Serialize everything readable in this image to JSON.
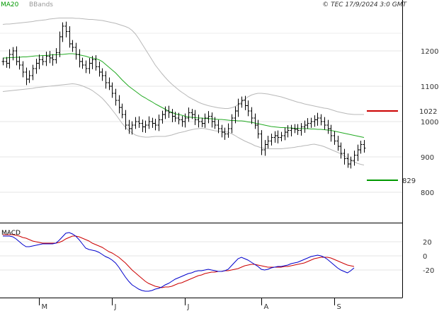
{
  "header": {
    "ma_label": "MA20",
    "bbands_label": "BBands",
    "copyright": "© TEC 17/9/2024 3:0 GMT"
  },
  "macd_label": "MACD",
  "levels": {
    "resistance": {
      "value": 1022,
      "label": "1022",
      "color": "#cc0000"
    },
    "support": {
      "value": 829,
      "label": "829",
      "color": "#009900"
    }
  },
  "colors": {
    "ma": "#22aa22",
    "bbands": "#b8b8b8",
    "macd": "#0000cc",
    "signal": "#cc0000",
    "ma_label": "#009900",
    "bbands_label": "#999999"
  },
  "chart_data": [
    {
      "type": "line",
      "title": "",
      "ylim": [
        700,
        1300
      ],
      "y_ticks": [
        800,
        900,
        1000,
        1100,
        1200
      ],
      "y_tick_labels": [
        "800",
        "900",
        "1000",
        "1100",
        "1200"
      ],
      "x_ticks": [
        {
          "label": "M",
          "index": 11
        },
        {
          "label": "J",
          "index": 33
        },
        {
          "label": "J",
          "index": 55
        },
        {
          "label": "A",
          "index": 78
        },
        {
          "label": "S",
          "index": 100
        }
      ],
      "series": [
        {
          "name": "",
          "kind": "ohlc",
          "close": [
            1170,
            1165,
            1190,
            1200,
            1170,
            1160,
            1140,
            1120,
            1130,
            1150,
            1165,
            1175,
            1170,
            1185,
            1180,
            1175,
            1195,
            1240,
            1270,
            1255,
            1220,
            1210,
            1190,
            1170,
            1160,
            1150,
            1165,
            1175,
            1155,
            1140,
            1130,
            1110,
            1100,
            1080,
            1060,
            1040,
            1020,
            990,
            980,
            990,
            1000,
            995,
            985,
            990,
            1000,
            995,
            990,
            1005,
            1020,
            1030,
            1025,
            1015,
            1010,
            1005,
            1000,
            1010,
            1025,
            1020,
            1005,
            1000,
            995,
            1010,
            1015,
            1000,
            990,
            980,
            970,
            965,
            980,
            1010,
            1030,
            1050,
            1060,
            1045,
            1030,
            1010,
            990,
            965,
            920,
            935,
            945,
            955,
            960,
            955,
            960,
            970,
            975,
            980,
            978,
            975,
            985,
            990,
            995,
            1000,
            1005,
            1010,
            1000,
            990,
            980,
            960,
            945,
            930,
            910,
            895,
            880,
            890,
            905,
            920,
            935,
            925
          ],
          "high_offset": 18,
          "low_offset": 18
        },
        {
          "name": "MA20",
          "values": [
            1180,
            1180,
            1181,
            1181,
            1182,
            1182,
            1183,
            1183,
            1184,
            1185,
            1186,
            1186,
            1187,
            1187,
            1188,
            1189,
            1189,
            1190,
            1190,
            1191,
            1192,
            1192,
            1191,
            1189,
            1187,
            1185,
            1182,
            1180,
            1178,
            1175,
            1170,
            1162,
            1154,
            1146,
            1138,
            1128,
            1118,
            1109,
            1100,
            1093,
            1086,
            1079,
            1072,
            1067,
            1061,
            1056,
            1050,
            1045,
            1040,
            1035,
            1030,
            1026,
            1022,
            1020,
            1018,
            1015,
            1013,
            1012,
            1011,
            1010,
            1010,
            1009,
            1008,
            1008,
            1007,
            1006,
            1006,
            1005,
            1004,
            1003,
            1003,
            1002,
            1002,
            1001,
            999,
            998,
            996,
            994,
            992,
            990,
            988,
            986,
            985,
            984,
            983,
            983,
            982,
            982,
            981,
            981,
            980,
            980,
            980,
            979,
            979,
            978,
            978,
            977,
            976,
            975,
            973,
            971,
            969,
            967,
            965,
            963,
            961,
            959,
            957,
            955
          ]
        },
        {
          "name": "BBands",
          "upper": [
            1275,
            1276,
            1276,
            1277,
            1278,
            1279,
            1280,
            1281,
            1282,
            1283,
            1285,
            1286,
            1287,
            1288,
            1290,
            1291,
            1292,
            1293,
            1293,
            1293,
            1293,
            1293,
            1292,
            1292,
            1291,
            1290,
            1289,
            1289,
            1288,
            1287,
            1286,
            1284,
            1282,
            1280,
            1278,
            1275,
            1272,
            1269,
            1265,
            1258,
            1248,
            1235,
            1220,
            1205,
            1190,
            1175,
            1160,
            1148,
            1136,
            1125,
            1115,
            1106,
            1098,
            1090,
            1083,
            1077,
            1070,
            1065,
            1060,
            1055,
            1051,
            1048,
            1045,
            1043,
            1041,
            1039,
            1038,
            1037,
            1037,
            1039,
            1042,
            1048,
            1055,
            1063,
            1070,
            1075,
            1078,
            1080,
            1080,
            1079,
            1078,
            1076,
            1074,
            1072,
            1070,
            1067,
            1064,
            1061,
            1058,
            1055,
            1053,
            1050,
            1048,
            1046,
            1044,
            1042,
            1040,
            1038,
            1037,
            1034,
            1031,
            1028,
            1026,
            1024,
            1022,
            1021,
            1020,
            1020,
            1020,
            1020
          ],
          "lower": [
            1085,
            1086,
            1087,
            1088,
            1089,
            1090,
            1091,
            1092,
            1093,
            1094,
            1096,
            1097,
            1098,
            1099,
            1100,
            1101,
            1102,
            1103,
            1104,
            1105,
            1106,
            1107,
            1106,
            1104,
            1101,
            1097,
            1093,
            1088,
            1081,
            1074,
            1066,
            1056,
            1045,
            1033,
            1021,
            1008,
            995,
            984,
            975,
            968,
            962,
            959,
            957,
            956,
            956,
            957,
            958,
            958,
            958,
            958,
            960,
            962,
            965,
            968,
            970,
            972,
            975,
            977,
            979,
            980,
            981,
            980,
            978,
            976,
            974,
            973,
            972,
            971,
            970,
            966,
            961,
            955,
            950,
            945,
            941,
            937,
            932,
            929,
            926,
            924,
            923,
            923,
            923,
            923,
            923,
            924,
            925,
            926,
            927,
            929,
            930,
            932,
            933,
            935,
            936,
            934,
            932,
            929,
            925,
            921,
            917,
            913,
            909,
            903,
            897,
            891,
            886,
            882,
            879,
            877
          ]
        }
      ]
    },
    {
      "type": "line",
      "title": "MACD",
      "ylim": [
        -55,
        45
      ],
      "y_ticks": [
        20,
        0,
        -20
      ],
      "y_tick_labels": [
        "20",
        "0",
        "-20"
      ],
      "series": [
        {
          "name": "MACD",
          "values": [
            28,
            28,
            28,
            27,
            24,
            20,
            16,
            13,
            13,
            14,
            15,
            16,
            17,
            17,
            17,
            17,
            18,
            22,
            27,
            32,
            33,
            31,
            28,
            23,
            17,
            11,
            9,
            8,
            7,
            5,
            2,
            -1,
            -3,
            -6,
            -10,
            -16,
            -23,
            -30,
            -36,
            -41,
            -44,
            -47,
            -49,
            -50,
            -50,
            -49,
            -47,
            -46,
            -44,
            -41,
            -39,
            -36,
            -33,
            -31,
            -29,
            -27,
            -25,
            -24,
            -22,
            -21,
            -21,
            -20,
            -19,
            -20,
            -21,
            -22,
            -22,
            -21,
            -19,
            -14,
            -9,
            -4,
            -2,
            -4,
            -6,
            -9,
            -12,
            -15,
            -19,
            -20,
            -19,
            -17,
            -16,
            -15,
            -15,
            -14,
            -13,
            -11,
            -10,
            -9,
            -7,
            -5,
            -3,
            -1,
            0,
            1,
            0,
            -2,
            -5,
            -9,
            -13,
            -17,
            -20,
            -22,
            -24,
            -21,
            -17
          ]
        },
        {
          "name": "Signal",
          "values": [
            30,
            30,
            30,
            30,
            29,
            28,
            26,
            25,
            23,
            21,
            20,
            19,
            18,
            18,
            18,
            18,
            18,
            19,
            21,
            24,
            26,
            28,
            28,
            27,
            25,
            23,
            21,
            18,
            16,
            14,
            12,
            9,
            6,
            4,
            1,
            -2,
            -6,
            -10,
            -15,
            -20,
            -24,
            -28,
            -32,
            -36,
            -39,
            -41,
            -43,
            -44,
            -45,
            -44,
            -44,
            -43,
            -41,
            -39,
            -38,
            -36,
            -34,
            -32,
            -30,
            -28,
            -27,
            -25,
            -24,
            -23,
            -23,
            -22,
            -22,
            -21,
            -21,
            -20,
            -19,
            -18,
            -16,
            -14,
            -13,
            -12,
            -12,
            -13,
            -14,
            -15,
            -16,
            -16,
            -16,
            -16,
            -16,
            -15,
            -15,
            -14,
            -13,
            -12,
            -11,
            -10,
            -8,
            -6,
            -4,
            -3,
            -2,
            -2,
            -2,
            -3,
            -5,
            -7,
            -9,
            -11,
            -13,
            -14,
            -15
          ]
        }
      ]
    }
  ]
}
